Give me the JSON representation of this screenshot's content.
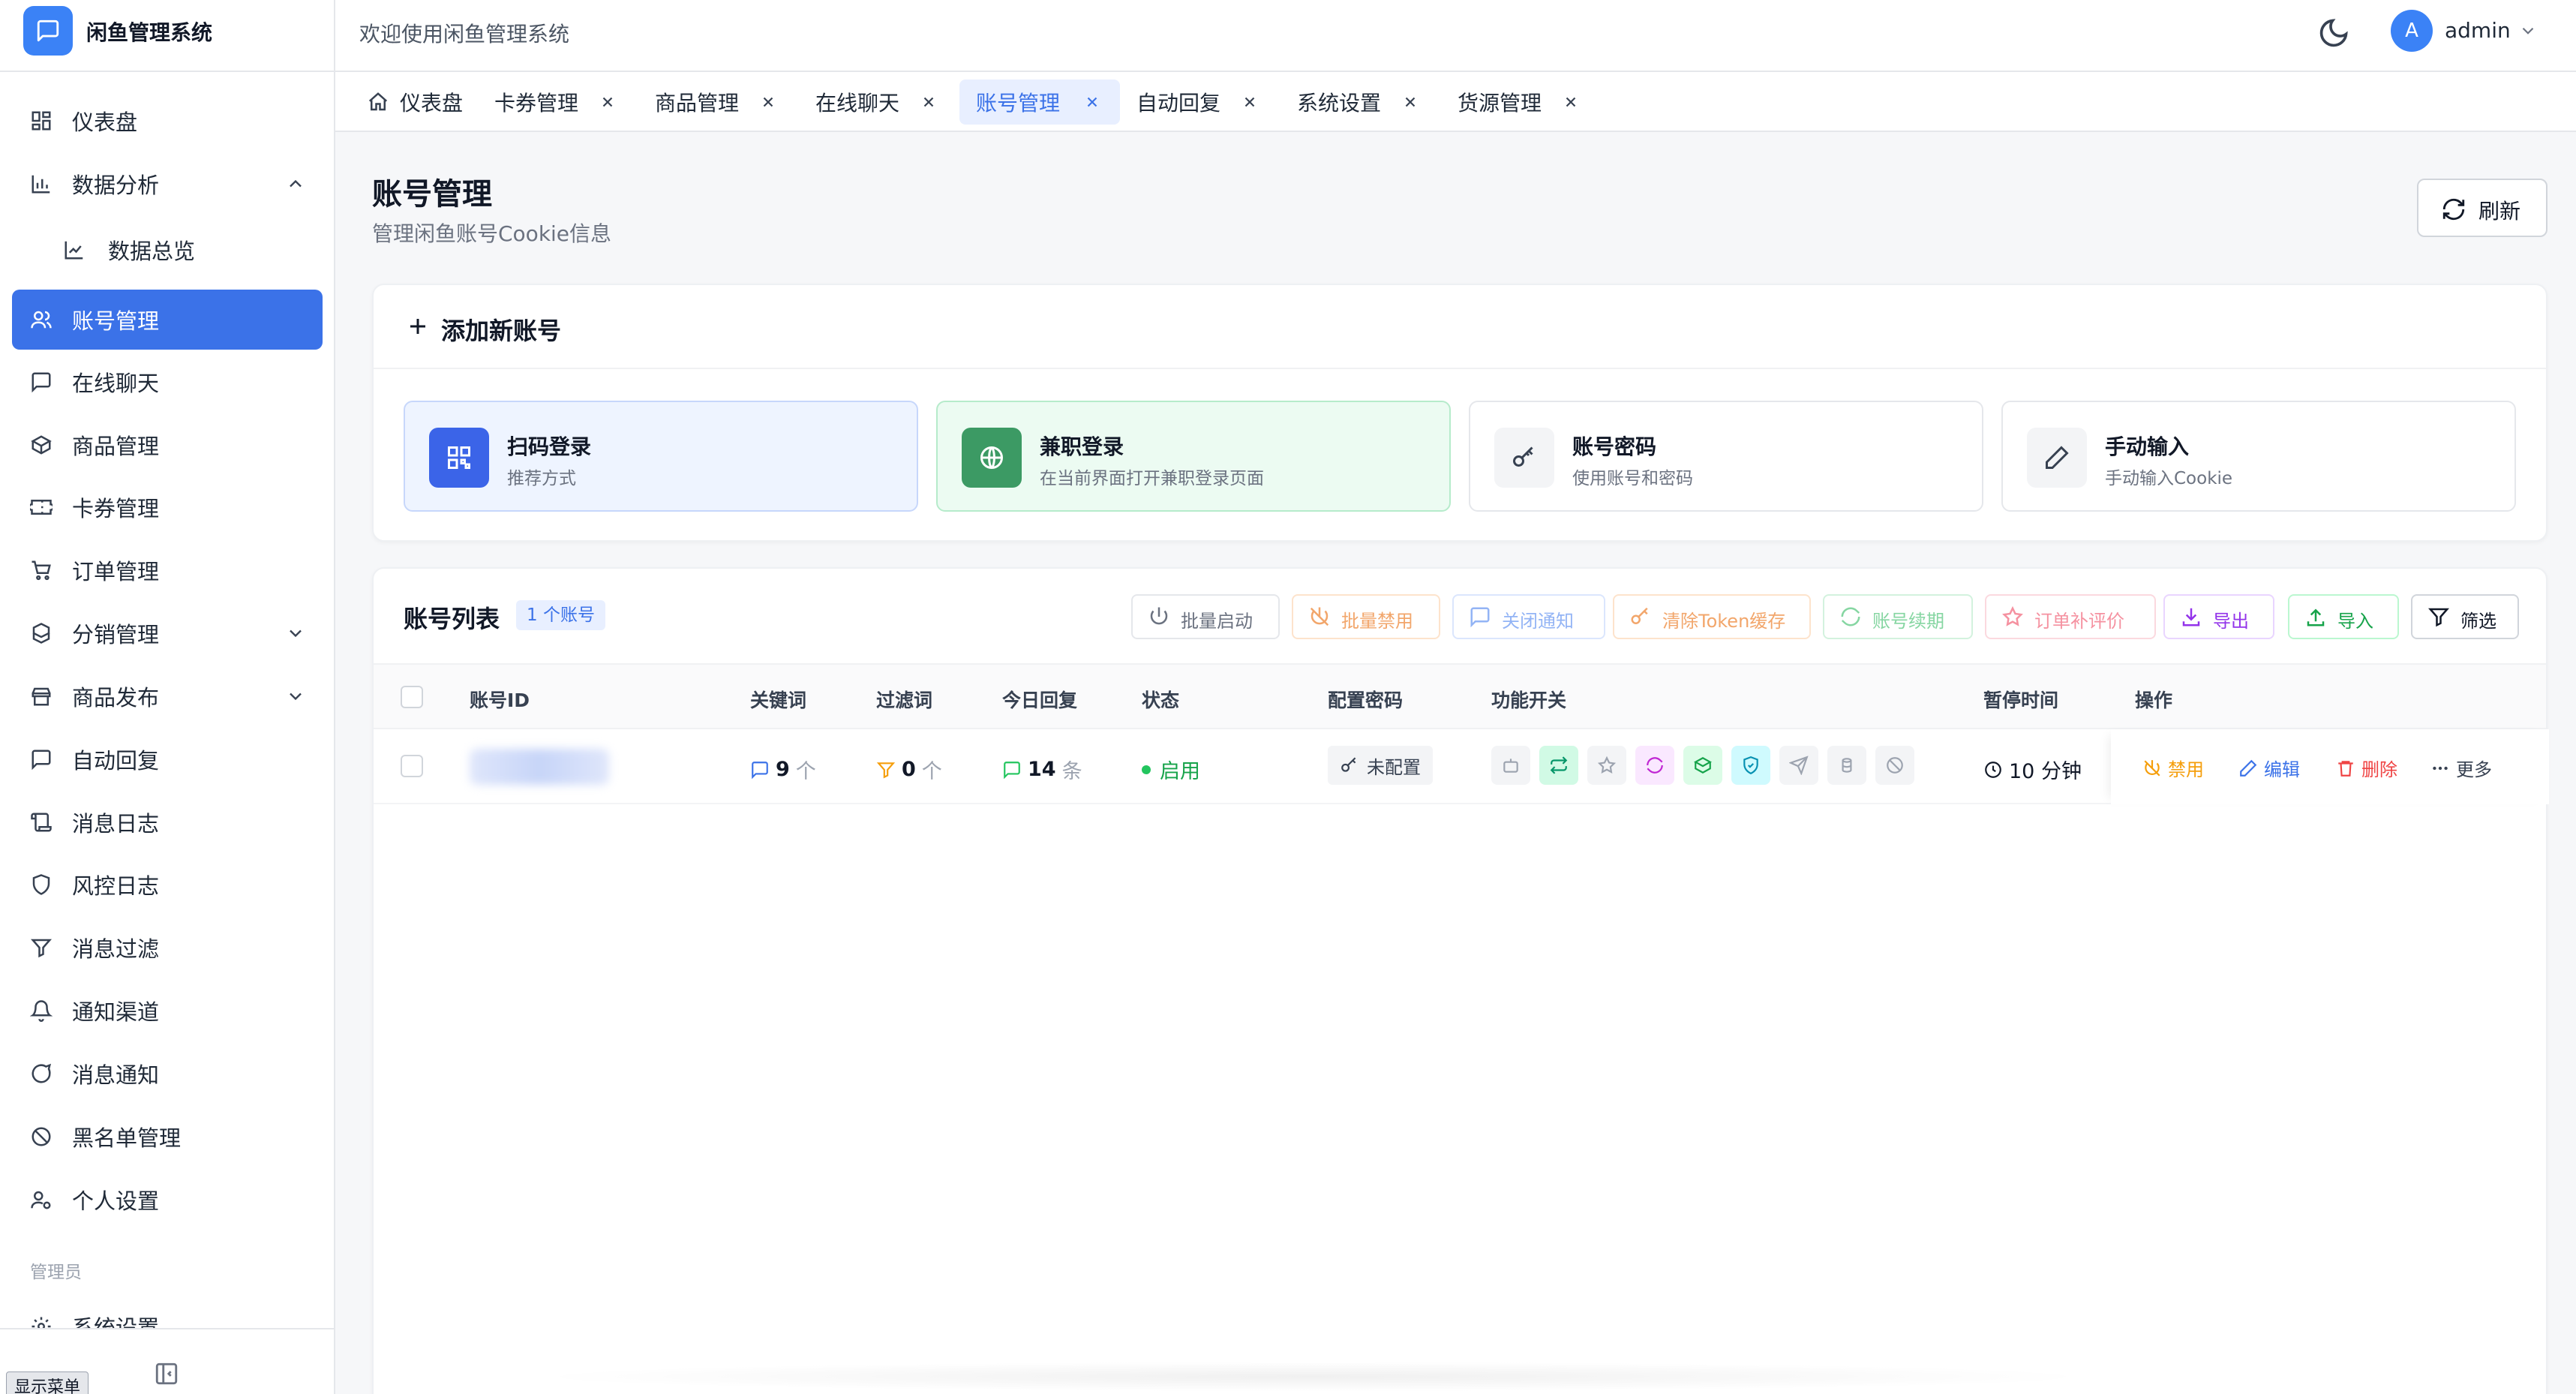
{
  "brand": {
    "name": "闲鱼管理系统"
  },
  "header": {
    "welcome": "欢迎使用闲鱼管理系统",
    "avatar_letter": "A",
    "username": "admin"
  },
  "sidebar": {
    "items": [
      {
        "label": "仪表盘",
        "icon": "dashboard-icon"
      },
      {
        "label": "数据分析",
        "icon": "bar-chart-icon",
        "expanded": true
      },
      {
        "label": "数据总览",
        "icon": "line-chart-icon",
        "sub": true
      },
      {
        "label": "账号管理",
        "icon": "users-icon",
        "active": true
      },
      {
        "label": "在线聊天",
        "icon": "chat-icon"
      },
      {
        "label": "商品管理",
        "icon": "box-icon"
      },
      {
        "label": "卡券管理",
        "icon": "ticket-icon"
      },
      {
        "label": "订单管理",
        "icon": "cart-icon"
      },
      {
        "label": "分销管理",
        "icon": "boxes-icon",
        "expandable": true
      },
      {
        "label": "商品发布",
        "icon": "store-icon",
        "expandable": true
      },
      {
        "label": "自动回复",
        "icon": "message-icon"
      },
      {
        "label": "消息日志",
        "icon": "scroll-icon"
      },
      {
        "label": "风控日志",
        "icon": "shield-icon"
      },
      {
        "label": "消息过滤",
        "icon": "filter-icon"
      },
      {
        "label": "通知渠道",
        "icon": "bell-icon"
      },
      {
        "label": "消息通知",
        "icon": "bubble-icon"
      },
      {
        "label": "黑名单管理",
        "icon": "ban-icon"
      },
      {
        "label": "个人设置",
        "icon": "user-cog-icon"
      }
    ],
    "section_admin": "管理员",
    "admin_items": [
      {
        "label": "系统设置",
        "icon": "gear-icon"
      }
    ],
    "show_menu": "显示菜单"
  },
  "tabs": [
    {
      "label": "仪表盘",
      "home": true
    },
    {
      "label": "卡券管理"
    },
    {
      "label": "商品管理"
    },
    {
      "label": "在线聊天"
    },
    {
      "label": "账号管理",
      "active": true
    },
    {
      "label": "自动回复"
    },
    {
      "label": "系统设置"
    },
    {
      "label": "货源管理"
    }
  ],
  "page": {
    "title": "账号管理",
    "subtitle": "管理闲鱼账号Cookie信息",
    "refresh": "刷新"
  },
  "add_account": {
    "title": "添加新账号",
    "methods": [
      {
        "title": "扫码登录",
        "desc": "推荐方式"
      },
      {
        "title": "兼职登录",
        "desc": "在当前界面打开兼职登录页面"
      },
      {
        "title": "账号密码",
        "desc": "使用账号和密码"
      },
      {
        "title": "手动输入",
        "desc": "手动输入Cookie"
      }
    ]
  },
  "account_list": {
    "title": "账号列表",
    "count_badge": "1 个账号",
    "toolbar": [
      "批量启动",
      "批量禁用",
      "关闭通知",
      "清除Token缓存",
      "账号续期",
      "订单补评价",
      "导出",
      "导入",
      "筛选"
    ],
    "columns": [
      "账号ID",
      "关键词",
      "过滤词",
      "今日回复",
      "状态",
      "配置密码",
      "功能开关",
      "暂停时间",
      "操作"
    ],
    "rows": [
      {
        "keywords_count": "9",
        "keywords_unit": "个",
        "filters_count": "0",
        "filters_unit": "个",
        "replies_count": "14",
        "replies_unit": "条",
        "status": "启用",
        "password": "未配置",
        "pause_time": "10 分钟",
        "actions": [
          "禁用",
          "编辑",
          "删除",
          "更多"
        ]
      }
    ]
  },
  "colors": {
    "accent": "#3b72e8",
    "success": "#22c55e",
    "danger": "#ef4444",
    "warning": "#f59e0b"
  }
}
